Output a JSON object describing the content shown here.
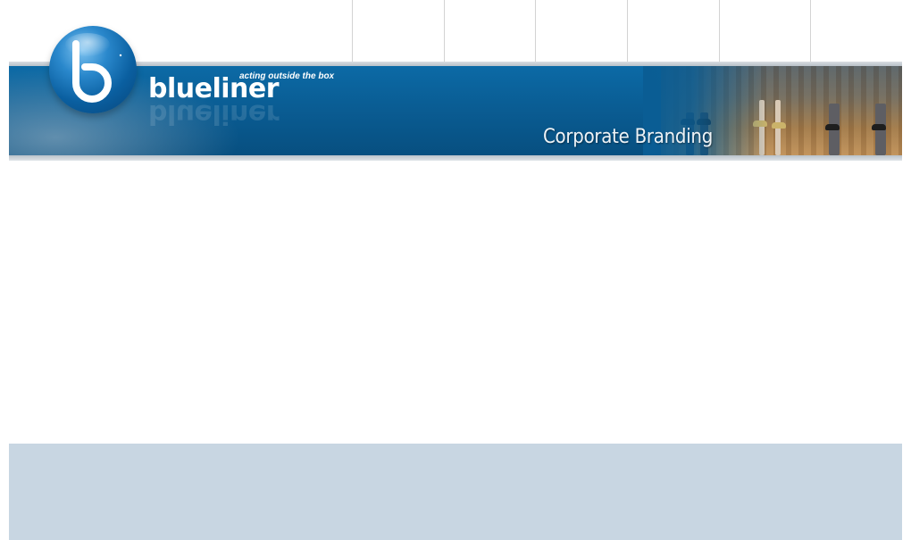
{
  "header": {
    "nav_slot_count": 6,
    "tagline": "acting outside the box",
    "brand": "blueliner",
    "section_title": "Corporate Branding"
  },
  "logo": {
    "icon": "blueliner-b-logo-icon"
  },
  "colors": {
    "banner_blue": "#0a5d94",
    "footer_blue": "#c8d6e2"
  }
}
